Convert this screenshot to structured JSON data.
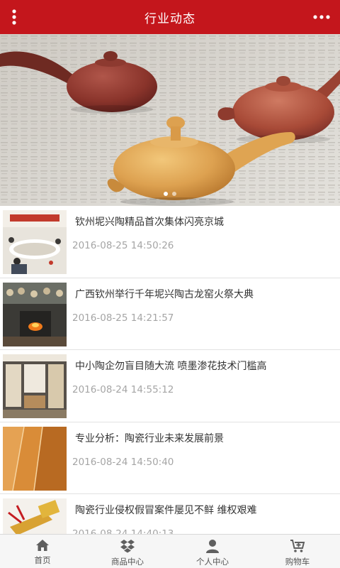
{
  "header": {
    "title": "行业动态",
    "menu_icon": "vertical-dots-icon",
    "more_icon": "horizontal-dots-icon",
    "background_color": "#c4161c"
  },
  "banner": {
    "image_subject": "teapots on newspaper",
    "slide_count": 2,
    "active_slide": 1
  },
  "news": [
    {
      "title": "钦州坭兴陶精品首次集体闪亮京城",
      "date": "2016-08-25 14:50:26"
    },
    {
      "title": "广西钦州举行千年坭兴陶古龙窑火祭大典",
      "date": "2016-08-25 14:21:57"
    },
    {
      "title": "中小陶企勿盲目随大流 喷墨渗花技术门槛高",
      "date": "2016-08-24 14:55:12"
    },
    {
      "title": "专业分析：陶瓷行业未来发展前景",
      "date": "2016-08-24 14:50:40"
    },
    {
      "title": "陶瓷行业侵权假冒案件屡见不鲜 维权艰难",
      "date": "2016-08-24 14:40:13"
    }
  ],
  "tabbar": {
    "items": [
      {
        "label": "首页",
        "icon": "home-icon"
      },
      {
        "label": "商品中心",
        "icon": "dropbox-icon"
      },
      {
        "label": "个人中心",
        "icon": "user-icon"
      },
      {
        "label": "购物车",
        "icon": "cart-icon"
      }
    ]
  }
}
